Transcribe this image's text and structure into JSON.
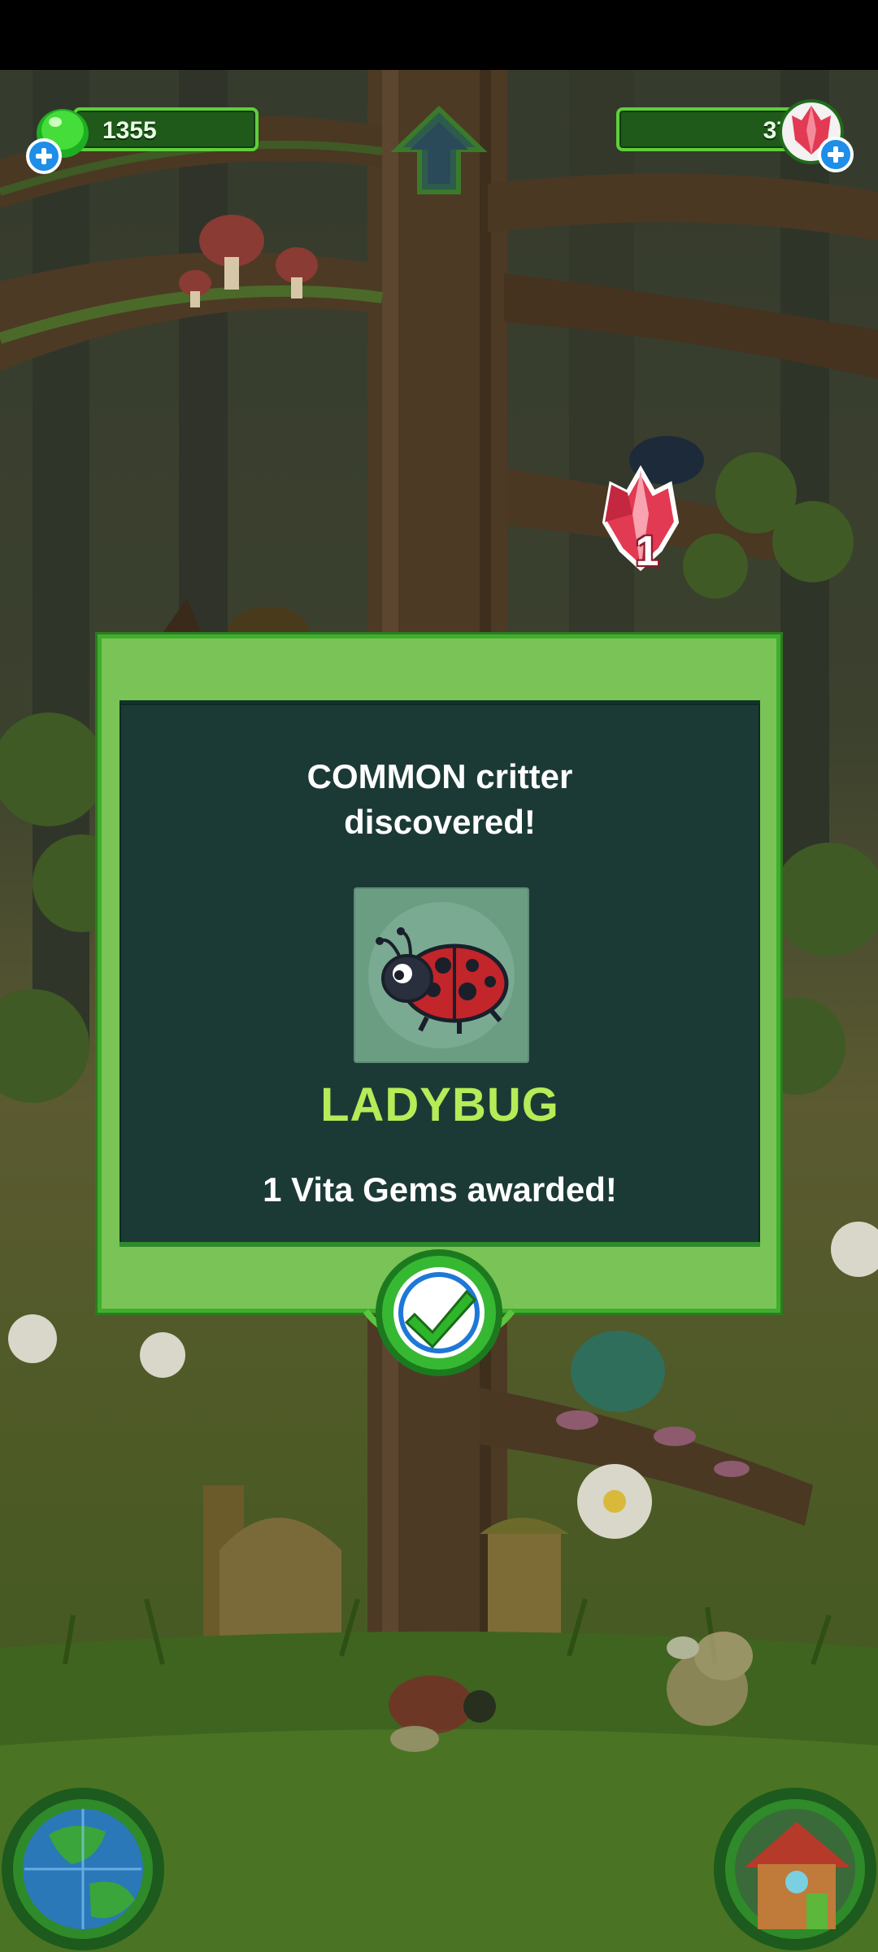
{
  "hud": {
    "gel_count": "1355",
    "gem_count": "37"
  },
  "reward_popup": {
    "amount": "1"
  },
  "dialog": {
    "title": "COMMON critter\ndiscovered!",
    "critter_name": "LADYBUG",
    "reward_text": "1 Vita Gems awarded!"
  },
  "icons": {
    "gel": "green-gel-icon",
    "gem": "red-gem-icon",
    "plus": "plus-icon",
    "home": "home-arrow-icon",
    "confirm": "checkmark-icon",
    "world": "globe-icon",
    "house": "house-icon"
  },
  "colors": {
    "dialog_frame": "#7ac357",
    "dialog_panel": "#1c3a35",
    "critter_name": "#b5ec57",
    "hud_bar": "#1f5a1b",
    "gem": "#e23a52"
  }
}
